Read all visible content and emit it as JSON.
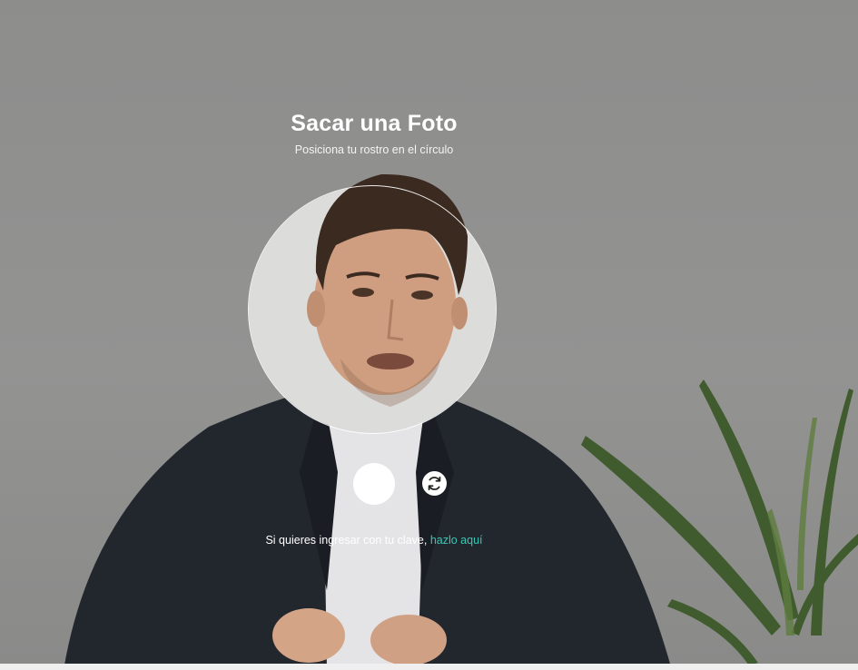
{
  "header": {
    "title": "Sacar una Foto",
    "subtitle": "Posiciona tu rostro en el círculo"
  },
  "camera": {
    "capture_button": "capture-shutter",
    "switch_icon": "camera-switch-icon"
  },
  "footer": {
    "login_text": "Si quieres ingresar con tu clave,",
    "login_link": "hazlo aquí"
  },
  "colors": {
    "accent": "#3cc7b3",
    "background": "#8f8f8e",
    "text": "#ffffff"
  }
}
